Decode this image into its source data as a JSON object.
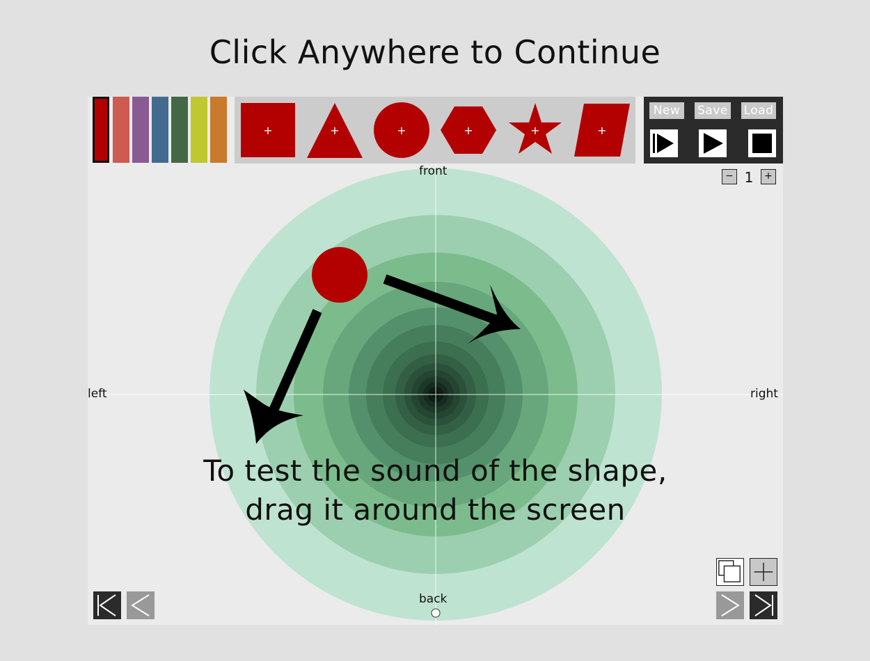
{
  "overlay": {
    "title": "Click Anywhere to Continue"
  },
  "palette": {
    "colors": [
      "#b20000",
      "#cf5a52",
      "#8a5a93",
      "#436b8e",
      "#446845",
      "#bfc92f",
      "#c97a2c"
    ],
    "selected": 0
  },
  "shapes": [
    {
      "name": "square",
      "icon": "square-icon",
      "add_glyph": "+"
    },
    {
      "name": "triangle",
      "icon": "triangle-icon",
      "add_glyph": "+"
    },
    {
      "name": "circle",
      "icon": "circle-icon",
      "add_glyph": "+"
    },
    {
      "name": "hexagon",
      "icon": "hexagon-icon",
      "add_glyph": "+"
    },
    {
      "name": "star",
      "icon": "star-icon",
      "add_glyph": "+"
    },
    {
      "name": "parallelogram",
      "icon": "parallelogram-icon",
      "add_glyph": "+"
    }
  ],
  "shape_color": "#b30000",
  "file": {
    "new_label": "New",
    "save_label": "Save",
    "load_label": "Load"
  },
  "playback": {
    "icons": [
      "play-from-start-icon",
      "play-icon",
      "stop-icon"
    ]
  },
  "zoom": {
    "minus": "−",
    "plus": "+",
    "value": "1"
  },
  "stage": {
    "labels": {
      "front": "front",
      "back": "back",
      "left": "left",
      "right": "right"
    }
  },
  "instruction": {
    "line1": "To test the sound of the shape,",
    "line2": "drag it around the screen"
  },
  "nav": {
    "icons": [
      "first-page-icon",
      "previous-page-icon",
      "next-page-icon",
      "last-page-icon",
      "duplicate-icon",
      "add-page-icon"
    ]
  }
}
